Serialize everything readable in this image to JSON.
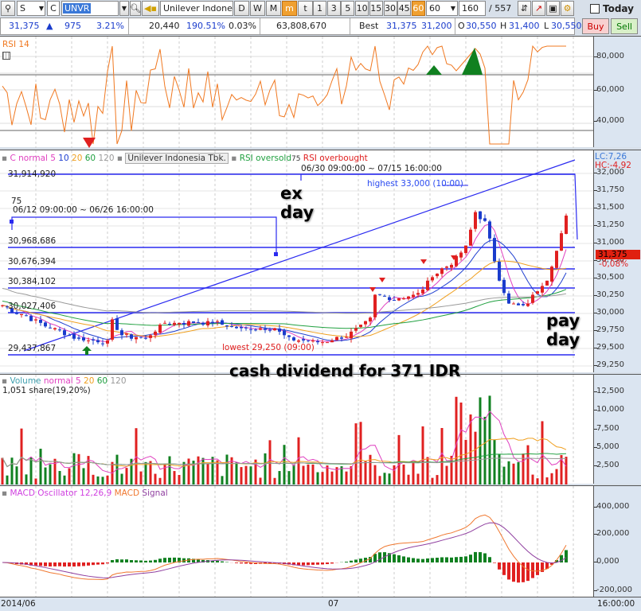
{
  "toolbar": {
    "market": "S",
    "type": "C",
    "symbol": "UNVR",
    "name": "Unilever Indones",
    "periods": [
      "D",
      "W",
      "M",
      "m",
      "t"
    ],
    "active_period": "m",
    "intervals": [
      "1",
      "3",
      "5",
      "10",
      "15",
      "30",
      "45",
      "60"
    ],
    "active_interval": "60",
    "interval_select": "60",
    "count": "160",
    "total": "/ 557",
    "today_label": "Today"
  },
  "quote": {
    "price": "31,375",
    "arrow": "▲",
    "change": "975",
    "change_pct": "3.21%",
    "volume": "20,440",
    "vol_ratio": "190.51%",
    "turnover": "0.03%",
    "value": "63,808,670",
    "best_label": "Best",
    "best_ask": "31,375",
    "best_bid": "31,200",
    "o_label": "O",
    "open": "30,550",
    "h_label": "H",
    "high": "31,400",
    "l_label": "L",
    "low": "30,550",
    "buy": "Buy",
    "sell": "Sell"
  },
  "rsi": {
    "title": "RSI 14",
    "ticks": [
      "80,000",
      "60,000",
      "40,000"
    ]
  },
  "price_panel": {
    "legend": {
      "c": "C normal 5",
      "ma10": "10",
      "ma20": "20",
      "ma60": "60",
      "ma120": "120",
      "name": "Unilever Indonesia Tbk.",
      "oversold": "RSI oversold",
      "n75": "75",
      "overbought": "RSI overbought"
    },
    "range1": {
      "n": "75",
      "period": "06/12 09:00:00 ~ 06/26 16:00:00"
    },
    "range2": {
      "period": "06/30 09:00:00 ~ 07/15 16:00:00"
    },
    "levels": [
      "31,914,920",
      "30,968,686",
      "30,676,394",
      "30,384,102",
      "30,027,406",
      "29,437,867"
    ],
    "highest": "highest 33,000 (10:00)",
    "lowest": "lowest 29,250 (09:00)",
    "lc": "LC:7,26",
    "hc": "HC:-4,92",
    "last": "31,375",
    "last_pct": "-0,08%",
    "ticks": [
      "32,000",
      "31,750",
      "31,500",
      "31,250",
      "31,000",
      "30,750",
      "30,500",
      "30,250",
      "30,000",
      "29,750",
      "29,500",
      "29,250"
    ],
    "annotations": {
      "ex1": "ex",
      "ex2": "day",
      "pay1": "pay",
      "pay2": "day",
      "dividend": "cash dividend for 371 IDR"
    }
  },
  "volume": {
    "legend": {
      "title": "Volume",
      "ma": "normal 5",
      "ma20": "20",
      "ma60": "60",
      "ma120": "120"
    },
    "info": "1,051 share(19,20%)",
    "ticks": [
      "12,500",
      "10,000",
      "7,500",
      "5,000",
      "2,500"
    ]
  },
  "macd": {
    "legend": {
      "osc": "MACD Oscillator 12,26,9",
      "macd": "MACD",
      "signal": "Signal"
    },
    "ticks": [
      "400,000",
      "200,000",
      "0,000",
      "-200,000"
    ]
  },
  "xaxis": {
    "labels": [
      "2014/06",
      "07"
    ],
    "time": "16:00:00"
  },
  "colors": {
    "up": "#e02020",
    "down": "#1a3ccc",
    "ma5": "#e040c0",
    "ma10": "#2040d0",
    "ma20": "#f0a020",
    "ma60": "#20a040",
    "ma120": "#999999",
    "rsi": "#f07820",
    "level": "#2a2af0"
  },
  "chart_data": {
    "type": "candlestick",
    "candles": 119,
    "close_keypoints": [
      [
        0,
        30120
      ],
      [
        8,
        29870
      ],
      [
        16,
        29650
      ],
      [
        22,
        29590
      ],
      [
        23,
        29900
      ],
      [
        25,
        29700
      ],
      [
        30,
        29650
      ],
      [
        34,
        29870
      ],
      [
        45,
        29880
      ],
      [
        50,
        29780
      ],
      [
        57,
        29800
      ],
      [
        60,
        29650
      ],
      [
        67,
        29600
      ],
      [
        70,
        29650
      ],
      [
        72,
        29700
      ],
      [
        77,
        29920
      ],
      [
        78,
        30270
      ],
      [
        82,
        30220
      ],
      [
        87,
        30280
      ],
      [
        90,
        30550
      ],
      [
        94,
        30720
      ],
      [
        97,
        30950
      ],
      [
        99,
        31460
      ],
      [
        101,
        31300
      ],
      [
        102,
        31050
      ],
      [
        104,
        30500
      ],
      [
        106,
        30150
      ],
      [
        109,
        30100
      ],
      [
        111,
        30250
      ],
      [
        114,
        30500
      ],
      [
        116,
        30900
      ],
      [
        118,
        31375
      ]
    ],
    "ylim": [
      29250,
      32000
    ]
  }
}
